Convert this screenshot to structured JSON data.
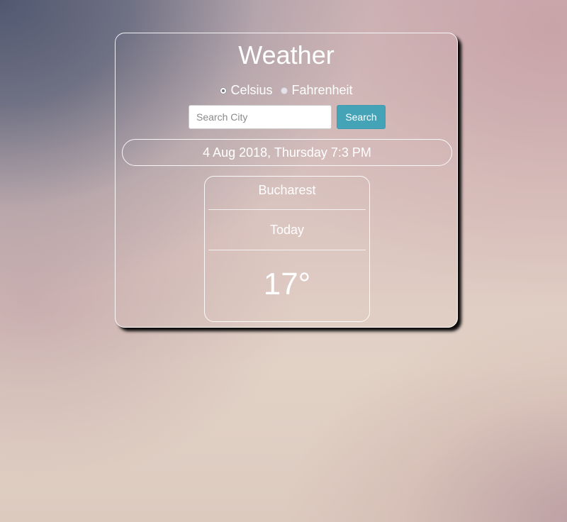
{
  "app": {
    "title": "Weather"
  },
  "units": {
    "options": [
      {
        "label": "Celsius",
        "selected": true
      },
      {
        "label": "Fahrenheit",
        "selected": false
      }
    ]
  },
  "search": {
    "placeholder": "Search City",
    "value": "",
    "button_label": "Search",
    "button_color": "#45a3b8"
  },
  "datetime": {
    "text": "4 Aug 2018, Thursday 7:3 PM"
  },
  "forecast": {
    "city": "Bucharest",
    "day": "Today",
    "temperature": "17°"
  }
}
